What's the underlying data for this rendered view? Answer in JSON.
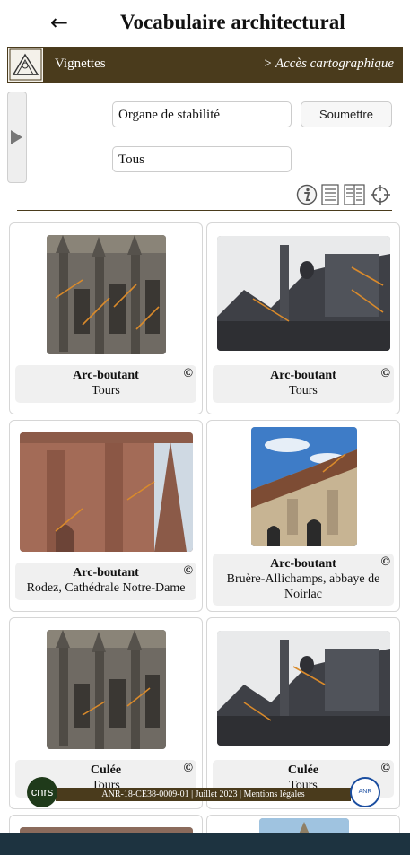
{
  "header": {
    "back_icon": "arrow-left-icon",
    "title": "Vocabulaire architectural"
  },
  "nav": {
    "logo_icon": "project-logo-icon",
    "left_label": "Vignettes",
    "right_label": "> Accès cartographique"
  },
  "sidebar": {
    "toggle_icon": "triangle-right-icon"
  },
  "filters": {
    "concept_value": "Organe de stabilité",
    "location_value": "Tous",
    "submit_label": "Soumettre"
  },
  "toolbar": {
    "info_icon": "info-icon",
    "list_icon": "list-view-icon",
    "detail_icon": "detail-view-icon",
    "target_icon": "crosshair-icon"
  },
  "cards": [
    {
      "title": "Arc-boutant",
      "place": "Tours",
      "copyright": "©"
    },
    {
      "title": "Arc-boutant",
      "place": "Tours",
      "copyright": "©"
    },
    {
      "title": "Arc-boutant",
      "place": "Rodez, Cathédrale Notre-Dame",
      "copyright": "©"
    },
    {
      "title": "Arc-boutant",
      "place": "Bruère-Allichamps, abbaye de Noirlac",
      "copyright": "©"
    },
    {
      "title": "Culée",
      "place": "Tours",
      "copyright": "©"
    },
    {
      "title": "Culée",
      "place": "Tours",
      "copyright": "©"
    }
  ],
  "footer": {
    "text": "ANR-18-CE38-0009-01 | Juillet 2023 | Mentions légales",
    "left_logo": "cnrs",
    "right_logo": "ANR"
  },
  "colors": {
    "brand_brown": "#4a3b1c",
    "bottom_bar": "#1d3340",
    "annotation_orange": "#d98a2b"
  }
}
